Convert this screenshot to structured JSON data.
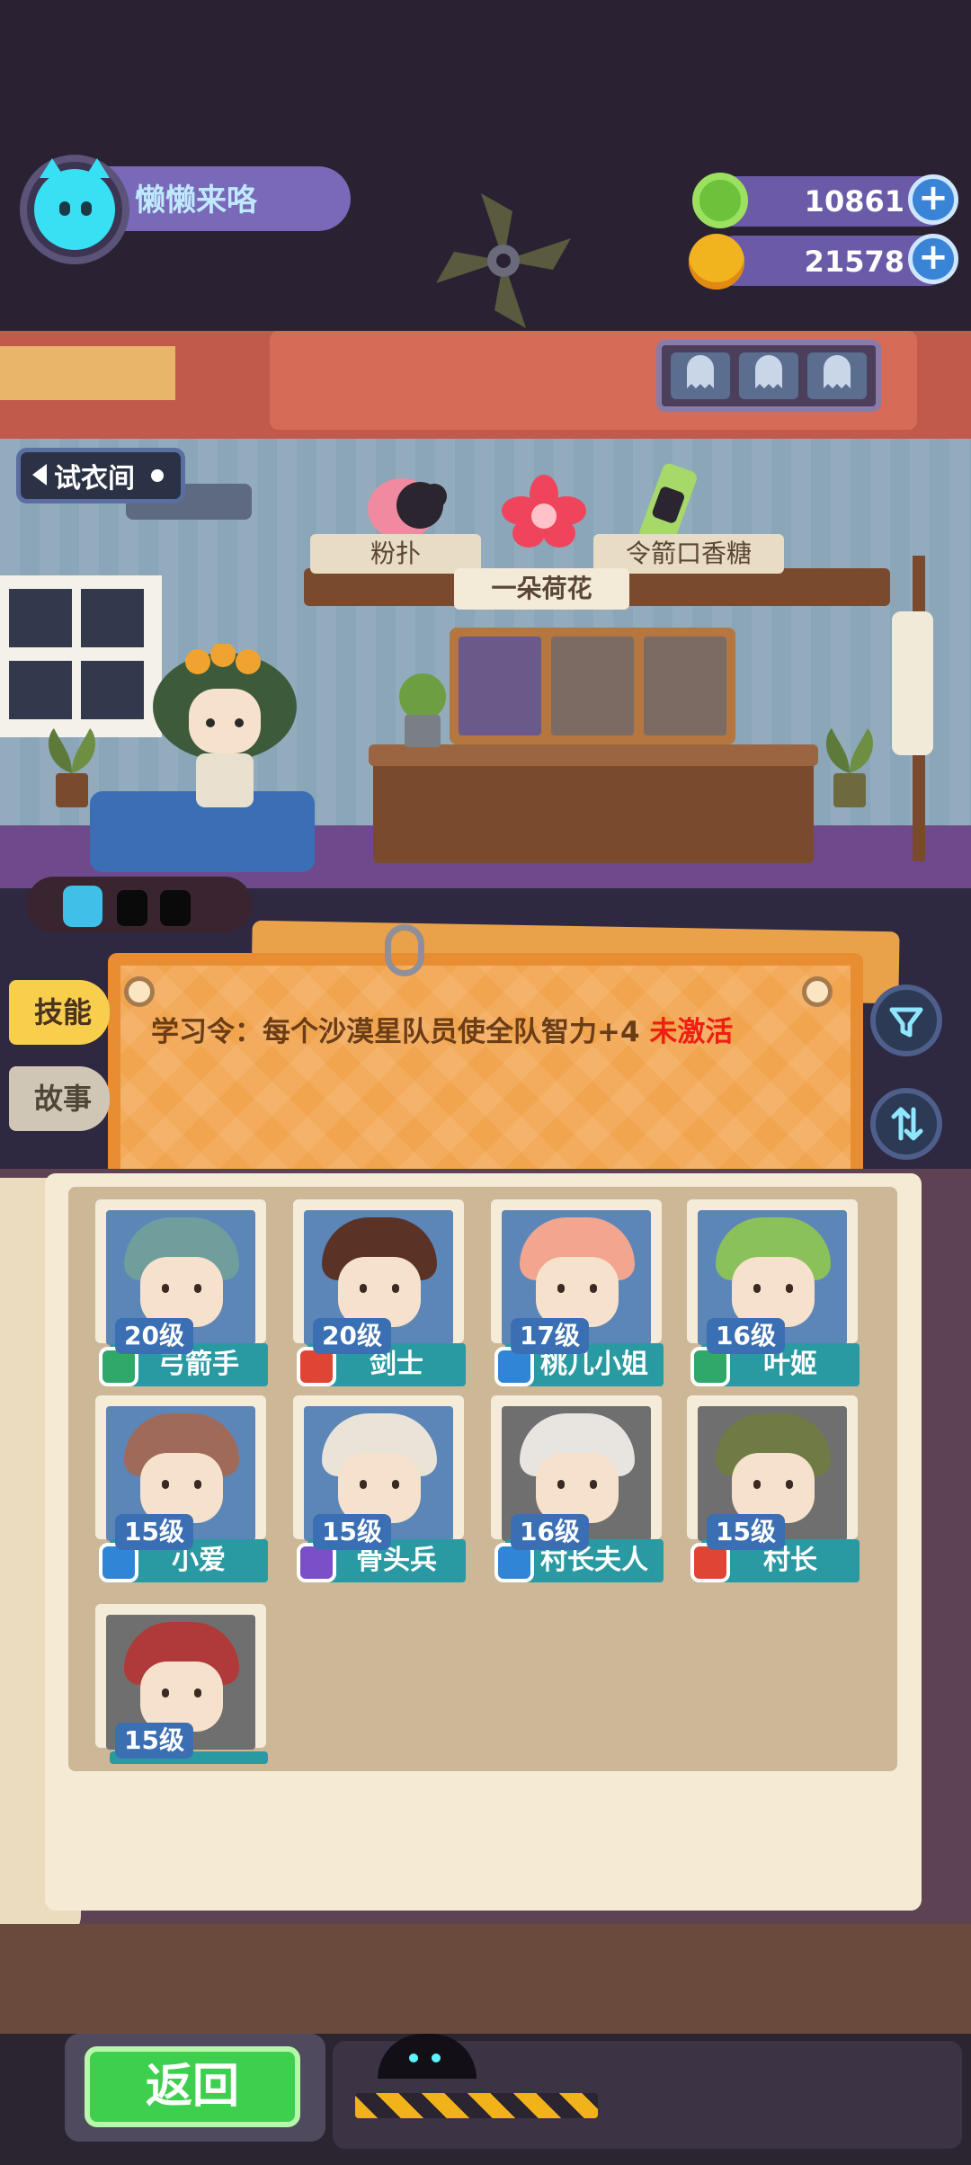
{
  "player": {
    "name": "懒懒来咯"
  },
  "currency": {
    "donut": {
      "value": "10861",
      "icon": "donut-coin-icon",
      "color": "#6cc23a"
    },
    "planet": {
      "value": "21578",
      "icon": "planet-coin-icon",
      "color": "#f2b41e"
    }
  },
  "room": {
    "fitting_room_label": "试衣间",
    "items": [
      {
        "name": "粉扑",
        "icon": "powder-puff-icon"
      },
      {
        "name": "一朵荷花",
        "icon": "lotus-flower-icon"
      },
      {
        "name": "令箭口香糖",
        "icon": "gum-icon"
      }
    ]
  },
  "tabs": {
    "skill": "技能",
    "story": "故事"
  },
  "skill": {
    "text": "学习令：每个沙漠星队员使全队智力+4",
    "status": "未激活",
    "status_color": "#f01e12"
  },
  "buttons": {
    "filter_icon": "filter-icon",
    "sort_icon": "sort-icon",
    "back": "返回"
  },
  "roster": [
    {
      "name": "弓箭手",
      "level": "20级",
      "class": "green",
      "class_color": "#2fa86a",
      "hair": "#6f9e9c"
    },
    {
      "name": "剑士",
      "level": "20级",
      "class": "red",
      "class_color": "#e04434",
      "hair": "#5a3326"
    },
    {
      "name": "桃几小姐",
      "level": "17级",
      "class": "blue",
      "class_color": "#2f86d6",
      "hair": "#f2a58f"
    },
    {
      "name": "叶姬",
      "level": "16级",
      "class": "green",
      "class_color": "#2fa86a",
      "hair": "#8ac15a"
    },
    {
      "name": "小爱",
      "level": "15级",
      "class": "blue",
      "class_color": "#2f86d6",
      "hair": "#a06a5a"
    },
    {
      "name": "骨头兵",
      "level": "15级",
      "class": "purple",
      "class_color": "#7a4fc8",
      "hair": "#e9e3d8"
    },
    {
      "name": "村长夫人",
      "level": "16级",
      "class": "blue",
      "class_color": "#2f86d6",
      "hair": "#e8e4e0"
    },
    {
      "name": "村长",
      "level": "15级",
      "class": "red",
      "class_color": "#e04434",
      "hair": "#6f7a45"
    },
    {
      "name": "",
      "level": "15级",
      "class": "blue",
      "class_color": "#2f86d6",
      "hair": "#b03a3a"
    }
  ]
}
